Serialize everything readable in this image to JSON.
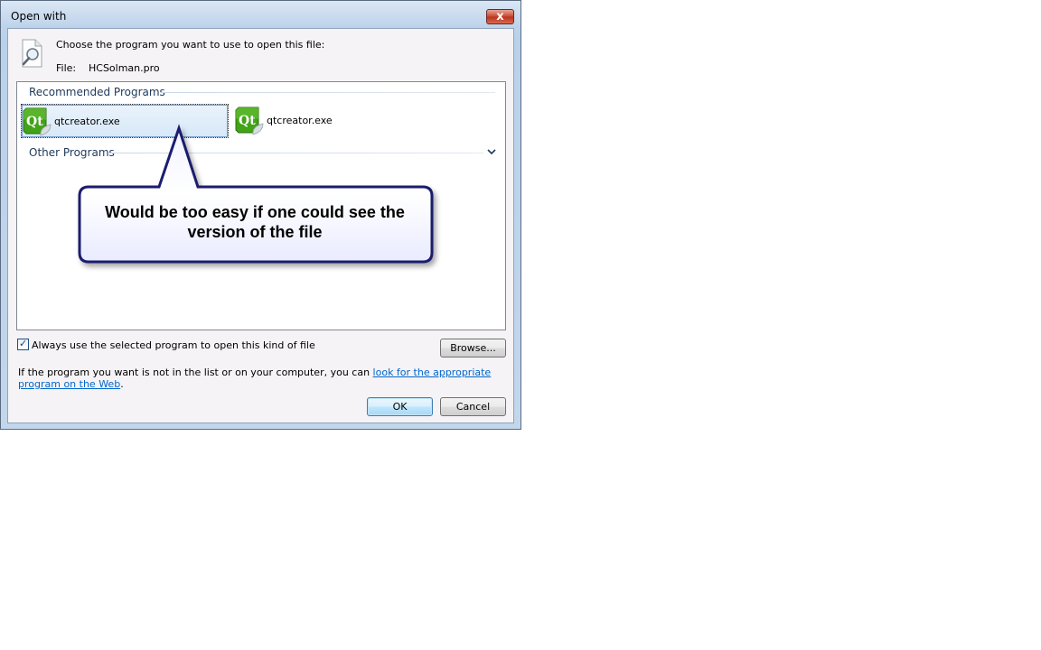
{
  "window": {
    "title": "Open with",
    "close_glyph": "x"
  },
  "header": {
    "prompt": "Choose the program you want to use to open this file:",
    "file_label": "File:",
    "file_name": "HCSolman.pro"
  },
  "recommended": {
    "header": "Recommended Programs",
    "items": [
      {
        "label": "qtcreator.exe",
        "icon": "qt-icon",
        "selected": true
      },
      {
        "label": "qtcreator.exe",
        "icon": "qt-icon",
        "selected": false
      }
    ]
  },
  "other": {
    "header": "Other Programs",
    "expand_icon": "chevron-down-icon"
  },
  "callout": {
    "line1": "Would be too easy if one could see the",
    "line2": "version of the file"
  },
  "options": {
    "always_use_label": "Always use the selected program to open this kind of file",
    "always_use_checked": true,
    "browse_label": "Browse..."
  },
  "info": {
    "prefix": "If the program you want is not in the list or on your computer, you can ",
    "link_text": "look for the appropriate program on the Web",
    "suffix": "."
  },
  "buttons": {
    "ok": "OK",
    "cancel": "Cancel"
  },
  "colors": {
    "link": "#0066cc",
    "group_header": "#1e395b",
    "callout_fill": "#ffffff",
    "callout_border": "#1a1f6e"
  }
}
